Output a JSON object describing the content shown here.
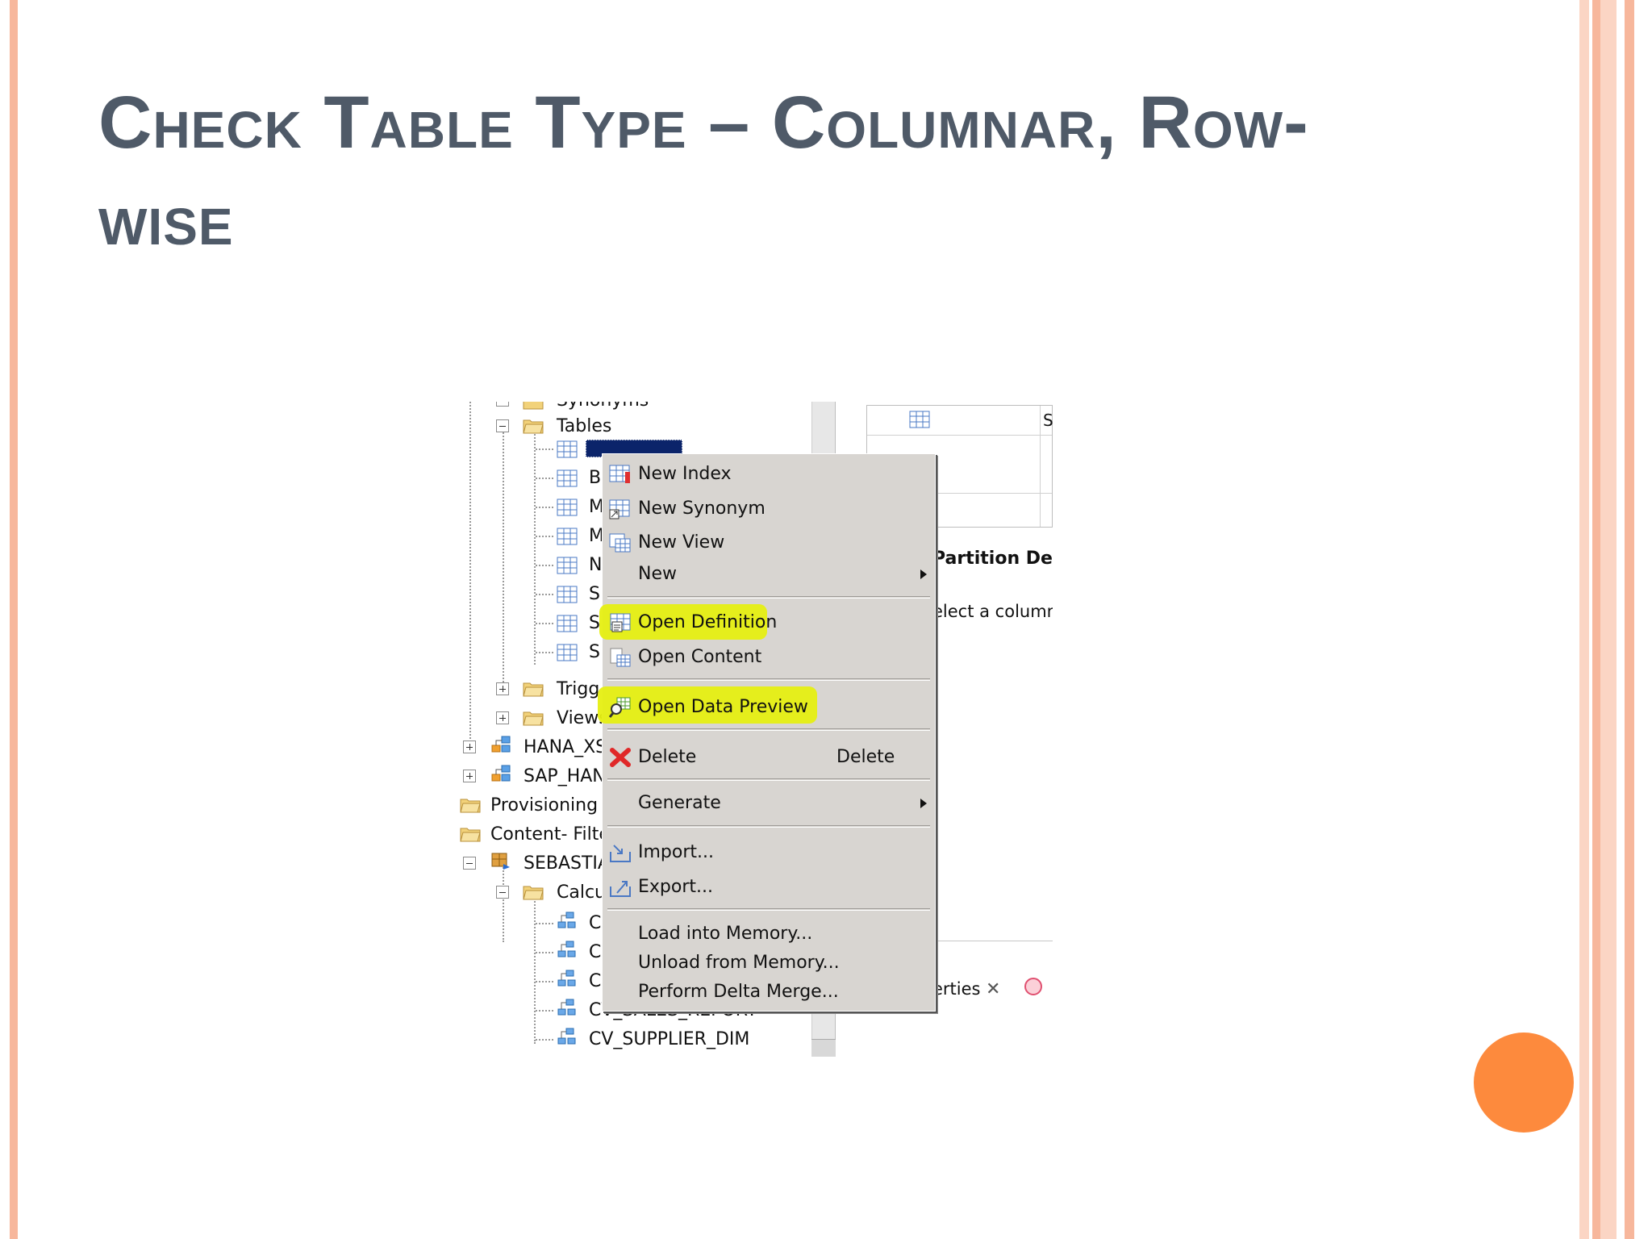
{
  "slide": {
    "title": "Check Table Type – Columnar, Row-wise",
    "accent_colors": {
      "stripe_light": "#fbd5c4",
      "stripe_mid": "#f7b79c",
      "orb": "#fd8a3d",
      "title_text": "#4f5a68"
    }
  },
  "tree": {
    "partial_top": "Synonyms",
    "tables_label": "Tables",
    "table_items": [
      "",
      "B",
      "M",
      "M",
      "N",
      "S",
      "S",
      "S"
    ],
    "triggers_label": "Trigg",
    "views_label": "Views",
    "hana_xs_label": "HANA_XS",
    "sap_hana_label": "SAP_HAN",
    "provisioning_label": "Provisioning",
    "content_filter_label": "Content- Filte",
    "sebastian_label": "SEBASTIA",
    "calc_label": "Calcu",
    "calc_items": [
      "C",
      "C",
      "C",
      "CV_SALES_REPORT",
      "CV_SUPPLIER_DIM"
    ]
  },
  "right_panel": {
    "grid_col_hint": "S",
    "partition_title": "Partition Det",
    "select_hint": "elect a column s",
    "properties_tab": "erties"
  },
  "context_menu": {
    "items": [
      {
        "label": "New Index",
        "icon": "new-index-icon"
      },
      {
        "label": "New Synonym",
        "icon": "new-synonym-icon"
      },
      {
        "label": "New View",
        "icon": "new-view-icon"
      },
      {
        "label": "New",
        "submenu": true
      },
      {
        "label": "Open Definition",
        "icon": "open-definition-icon",
        "highlighted": true
      },
      {
        "label": "Open Content",
        "icon": "open-content-icon"
      },
      {
        "label": "Open Data Preview",
        "icon": "data-preview-icon",
        "highlighted": true
      },
      {
        "label": "Delete",
        "icon": "delete-icon",
        "accelerator": "Delete"
      },
      {
        "label": "Generate",
        "submenu": true
      },
      {
        "label": "Import...",
        "icon": "import-icon"
      },
      {
        "label": "Export...",
        "icon": "export-icon"
      },
      {
        "label": "Load into Memory..."
      },
      {
        "label": "Unload from Memory..."
      },
      {
        "label": "Perform Delta Merge..."
      }
    ],
    "highlight_color": "#e6ef12"
  }
}
